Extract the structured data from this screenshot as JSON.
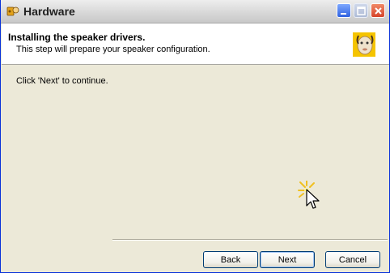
{
  "window": {
    "title": "Hardware"
  },
  "header": {
    "title": "Installing the speaker drivers.",
    "subtitle": "This step will prepare your speaker configuration."
  },
  "body": {
    "instruction": "Click 'Next' to continue."
  },
  "buttons": {
    "back": "Back",
    "next": "Next",
    "cancel": "Cancel"
  },
  "icons": {
    "app": "hardware-app-icon",
    "header": "mascot-icon",
    "minimize": "minimize-icon",
    "maximize": "maximize-icon",
    "close": "close-icon",
    "cursor": "mouse-cursor-icon"
  },
  "colors": {
    "close_button": "#d6432a",
    "minimize_button": "#2f61e0",
    "dialog_background": "#ece9d8"
  }
}
